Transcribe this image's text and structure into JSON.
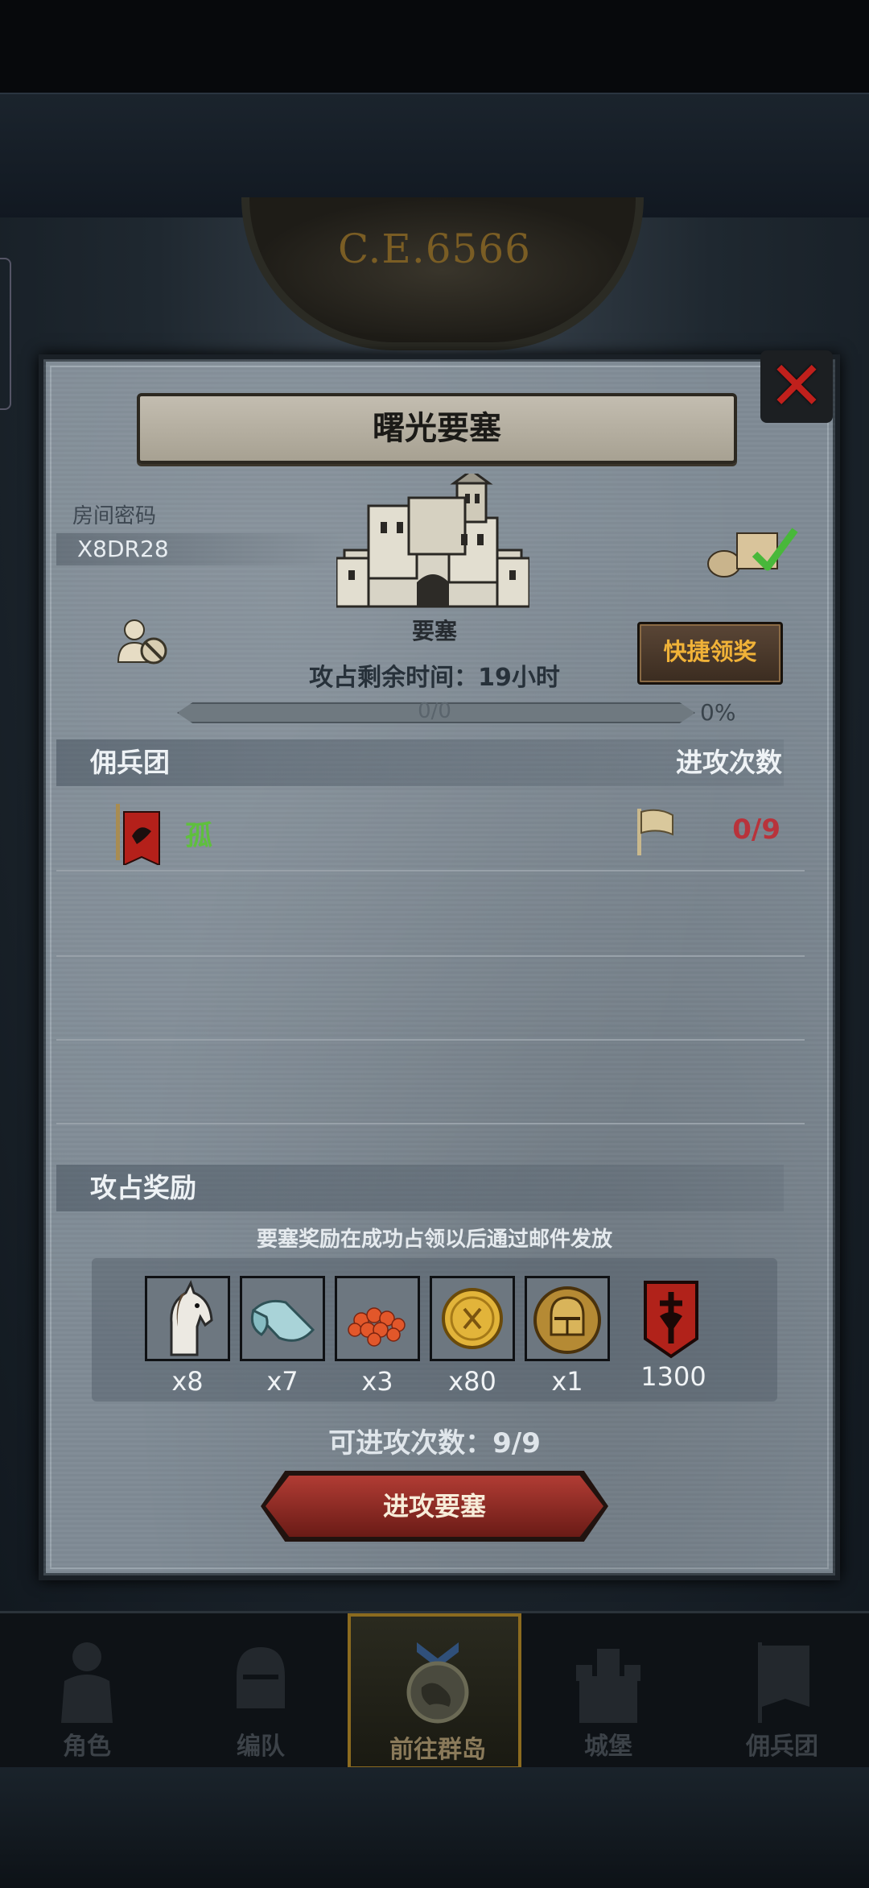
{
  "era_text": "C.E.6566",
  "dialog": {
    "title": "曙光要塞",
    "room_password_label": "房间密码",
    "room_password": "X8DR28",
    "fortress_label": "要塞",
    "quick_claim_label": "快捷领奖",
    "time_remaining": "攻占剩余时间：19小时",
    "progress": {
      "text": "0/0",
      "percent_text": "0%",
      "fraction": 0
    },
    "mercenary_header": "佣兵团",
    "attack_count_header": "进攻次数",
    "guilds": [
      {
        "name": "孤",
        "attacks": "0/9"
      }
    ],
    "rewards_header": "攻占奖励",
    "rewards_note": "要塞奖励在成功占领以后通过邮件发放",
    "rewards": [
      {
        "icon": "horse-icon",
        "qty": "x8"
      },
      {
        "icon": "cloth-icon",
        "qty": "x7"
      },
      {
        "icon": "fish-roe-icon",
        "qty": "x3"
      },
      {
        "icon": "gold-coin-icon",
        "qty": "x80"
      },
      {
        "icon": "helmet-medal-icon",
        "qty": "x1"
      },
      {
        "icon": "guild-banner-icon",
        "qty": "1300"
      }
    ],
    "available_attacks": "可进攻次数：9/9",
    "attack_button": "进攻要塞"
  },
  "nav": [
    {
      "label": "角色",
      "icon": "knight-icon",
      "active": false
    },
    {
      "label": "编队",
      "icon": "helmet-icon",
      "active": false
    },
    {
      "label": "前往群岛",
      "icon": "world-icon",
      "active": true
    },
    {
      "label": "城堡",
      "icon": "castle-icon",
      "active": false
    },
    {
      "label": "佣兵团",
      "icon": "mercenary-icon",
      "active": false
    }
  ],
  "colors": {
    "guild_name": "#5fbf3e",
    "attacks_count": "#b8333b",
    "quick_claim_text": "#f0b238",
    "close_x": "#c0201c"
  }
}
